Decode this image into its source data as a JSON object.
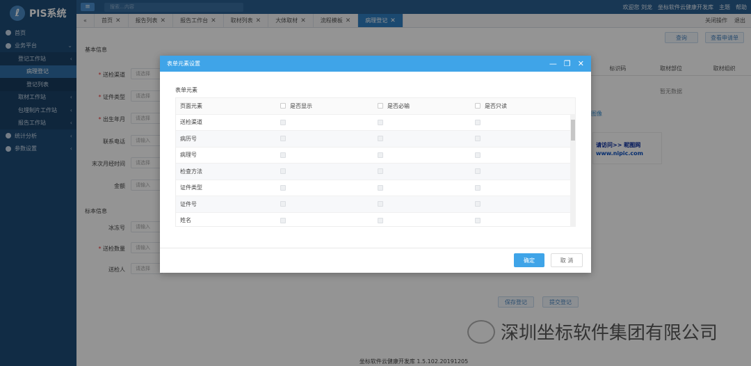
{
  "app": {
    "logo_mark": "ℓ",
    "title": "PIS系统"
  },
  "sidebar": {
    "items": [
      {
        "label": "首页",
        "level": 0
      },
      {
        "label": "业务平台",
        "level": 0
      },
      {
        "label": "登记工作站",
        "level": 1
      },
      {
        "label": "病理登记",
        "level": 2,
        "active": true
      },
      {
        "label": "登记列表",
        "level": 2
      },
      {
        "label": "取材工作站",
        "level": 1
      },
      {
        "label": "包埋制片工作站",
        "level": 1
      },
      {
        "label": "报告工作站",
        "level": 1
      },
      {
        "label": "统计分析",
        "level": 0
      },
      {
        "label": "参数设置",
        "level": 0
      }
    ]
  },
  "topbar": {
    "menu_icon": "≡",
    "search_placeholder": "搜索…内容",
    "welcome": "欢迎您 刘龙",
    "company_link": "坐标软件云健康开发库",
    "theme": "主题",
    "help": "帮助"
  },
  "tabs": {
    "items": [
      "首页",
      "报告列表",
      "报告工作台",
      "取材列表",
      "大体取材",
      "流程模板",
      "病理登记"
    ],
    "active_index": 6,
    "close_ops": "关闭操作",
    "logout": "退出"
  },
  "form": {
    "basic_title": "基本信息",
    "specimen_title": "标本信息",
    "fields": [
      {
        "label": "送检渠道",
        "required": true,
        "placeholder": "请选择"
      },
      {
        "label": "证件类型",
        "required": true,
        "placeholder": "请选择"
      },
      {
        "label": "出生年月",
        "required": true,
        "placeholder": "请选择"
      },
      {
        "label": "联系电话",
        "required": false,
        "placeholder": "请输入"
      },
      {
        "label": "末次月经时间",
        "required": false,
        "placeholder": "请选择"
      },
      {
        "label": "金额",
        "required": false,
        "placeholder": "请输入"
      },
      {
        "label": "冰冻号",
        "required": false,
        "placeholder": "请输入"
      },
      {
        "label": "送检数量",
        "required": true,
        "placeholder": "请输入"
      },
      {
        "label": "送检人",
        "required": false,
        "placeholder": "请选择"
      }
    ],
    "right_buttons": [
      "查询",
      "查看申请单"
    ],
    "table_headers": [
      "标识码",
      "取材部位",
      "取材组织"
    ],
    "no_data": "暂无数据",
    "image_tab": "图像",
    "save_button": "保存登记",
    "submit_button": "提交登记",
    "watermark_line1": "请访问>> 昵图网",
    "watermark_line2": "www.nipic.com"
  },
  "modal": {
    "title": "表单元素设置",
    "section_label": "表单元素",
    "headers": [
      "页面元素",
      "是否显示",
      "是否必输",
      "是否只读"
    ],
    "rows": [
      "送检渠道",
      "病历号",
      "病理号",
      "检查方法",
      "证件类型",
      "证件号",
      "姓名"
    ],
    "ok": "确定",
    "cancel": "取 消",
    "controls": {
      "minimize": "—",
      "restore": "❐",
      "close": "✕"
    }
  },
  "footer": "坐标软件云健康开发库 1.5.102.20191205",
  "company_name": "深圳坐标软件集团有限公司"
}
